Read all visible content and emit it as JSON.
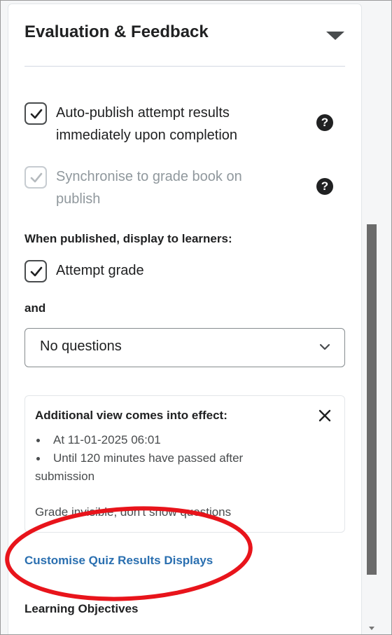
{
  "panel": {
    "title": "Evaluation & Feedback"
  },
  "options": [
    {
      "label_line1": "Auto-publish attempt results",
      "label_line2": "immediately upon completion",
      "checked": true,
      "disabled": false
    },
    {
      "label_line1": "Synchronise to grade book on",
      "label_line2": "publish",
      "checked": true,
      "disabled": true
    }
  ],
  "display": {
    "heading": "When published, display to learners:",
    "attempt_grade_label": "Attempt grade",
    "and_label": "and",
    "select_value": "No questions"
  },
  "additional_view": {
    "title": "Additional view comes into effect:",
    "items": [
      "At 11-01-2025 06:01",
      "Until 120 minutes have passed after"
    ],
    "item2_continuation": "submission",
    "footer": "Grade invisible, don't show questions"
  },
  "link": {
    "label": "Customise Quiz Results Displays"
  },
  "next_section": {
    "heading": "Learning Objectives"
  },
  "colors": {
    "link": "#2a6fb0",
    "annotation": "#e8141b",
    "scroll_thumb": "#6b6b6b"
  },
  "icons": {
    "collapse": "caret-down-icon",
    "help": "question-circle-icon",
    "check": "checkmark-icon",
    "chevron": "chevron-down-icon",
    "close": "close-icon"
  }
}
